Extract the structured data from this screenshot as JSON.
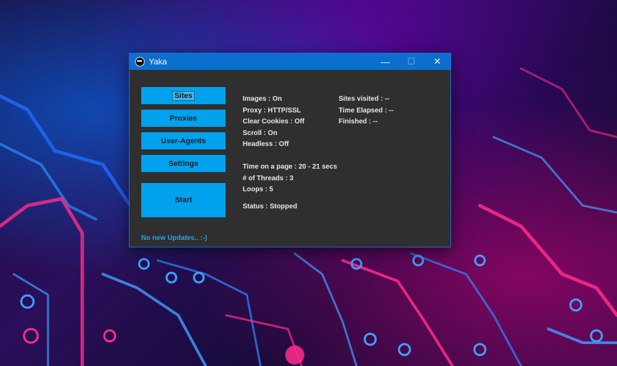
{
  "window": {
    "title": "Yaka",
    "minimize_glyph": "—",
    "maximize_glyph": "☐",
    "close_glyph": "✕"
  },
  "buttons": {
    "sites": "Sites",
    "proxies": "Proxies",
    "user_agents": "User-Agents",
    "settings": "Settings",
    "start": "Start"
  },
  "info_left": {
    "images": "Images : On",
    "proxy": "Proxy :  HTTP/SSL",
    "clear_cookies": "Clear Cookies : Off",
    "scroll": "Scroll : On",
    "headless": "Headless :  Off",
    "time_on_page": "Time on a page : 20 - 21 secs",
    "threads": "# of Threads : 3",
    "loops": "Loops : 5",
    "status": "Status : Stopped"
  },
  "info_right": {
    "sites_visited": "Sites visited : --",
    "time_elapsed": "Time Elapsed : --",
    "finished": "Finished : --"
  },
  "footer": {
    "update_text": "No new Updates.. :-)"
  },
  "colors": {
    "titlebar": "#0b6fcf",
    "button": "#00a2ed",
    "panel": "#2f2f2f",
    "link": "#1ea7f0"
  }
}
